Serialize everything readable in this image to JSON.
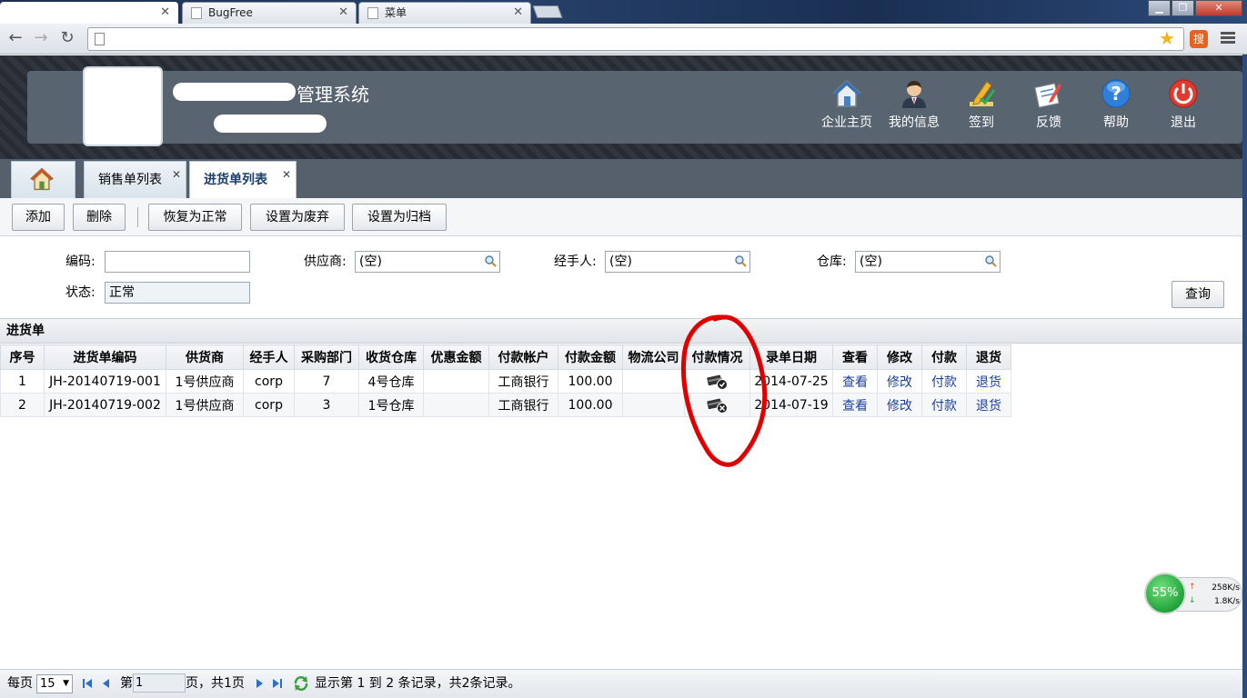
{
  "browser": {
    "tabs": [
      {
        "label": ""
      },
      {
        "label": "BugFree"
      },
      {
        "label": "菜单"
      }
    ],
    "url": ""
  },
  "header": {
    "title": "管理系统",
    "nav": [
      {
        "label": "企业主页",
        "icon": "home-icon"
      },
      {
        "label": "我的信息",
        "icon": "user-icon"
      },
      {
        "label": "签到",
        "icon": "sign-in-pencil-icon"
      },
      {
        "label": "反馈",
        "icon": "feedback-icon"
      },
      {
        "label": "帮助",
        "icon": "help-icon"
      },
      {
        "label": "退出",
        "icon": "power-icon"
      }
    ]
  },
  "tabs": [
    {
      "label": "销售单列表"
    },
    {
      "label": "进货单列表"
    }
  ],
  "actions": {
    "add": "添加",
    "delete": "删除",
    "restore": "恢复为正常",
    "discard": "设置为废弃",
    "archive": "设置为归档"
  },
  "filters": {
    "code_label": "编码:",
    "code_value": "",
    "supplier_label": "供应商:",
    "supplier_value": "(空)",
    "handler_label": "经手人:",
    "handler_value": "(空)",
    "warehouse_label": "仓库:",
    "warehouse_value": "(空)",
    "status_label": "状态:",
    "status_value": "正常",
    "query": "查询"
  },
  "grid": {
    "title": "进货单",
    "columns": [
      "序号",
      "进货单编码",
      "供货商",
      "经手人",
      "采购部门",
      "收货仓库",
      "优惠金额",
      "付款帐户",
      "付款金额",
      "物流公司",
      "付款情况",
      "录单日期",
      "查看",
      "修改",
      "付款",
      "退货"
    ],
    "rows": [
      {
        "no": "1",
        "code": "JH-20140719-001",
        "supplier": "1号供应商",
        "handler": "corp",
        "dept": "7",
        "warehouse": "4号仓库",
        "discount": "",
        "account": "工商银行",
        "amount": "100.00",
        "logistics": "",
        "pay_status": "paid",
        "date": "2014-07-25",
        "view": "查看",
        "edit": "修改",
        "pay": "付款",
        "return": "退货"
      },
      {
        "no": "2",
        "code": "JH-20140719-002",
        "supplier": "1号供应商",
        "handler": "corp",
        "dept": "3",
        "warehouse": "1号仓库",
        "discount": "",
        "account": "工商银行",
        "amount": "100.00",
        "logistics": "",
        "pay_status": "unpaid",
        "date": "2014-07-19",
        "view": "查看",
        "edit": "修改",
        "pay": "付款",
        "return": "退货"
      }
    ]
  },
  "pager": {
    "per_page_label": "每页",
    "page_size": "15",
    "page_prefix": "第",
    "page_value": "1",
    "page_suffix": "页，共1页",
    "summary": "显示第 1 到 2 条记录，共2条记录。"
  },
  "netwidget": {
    "percent": "55%",
    "up": "258K/s",
    "down": "1.8K/s"
  },
  "colors": {
    "header_panel": "#586470",
    "annotation": "#e00000",
    "link": "#1b3f9c"
  }
}
